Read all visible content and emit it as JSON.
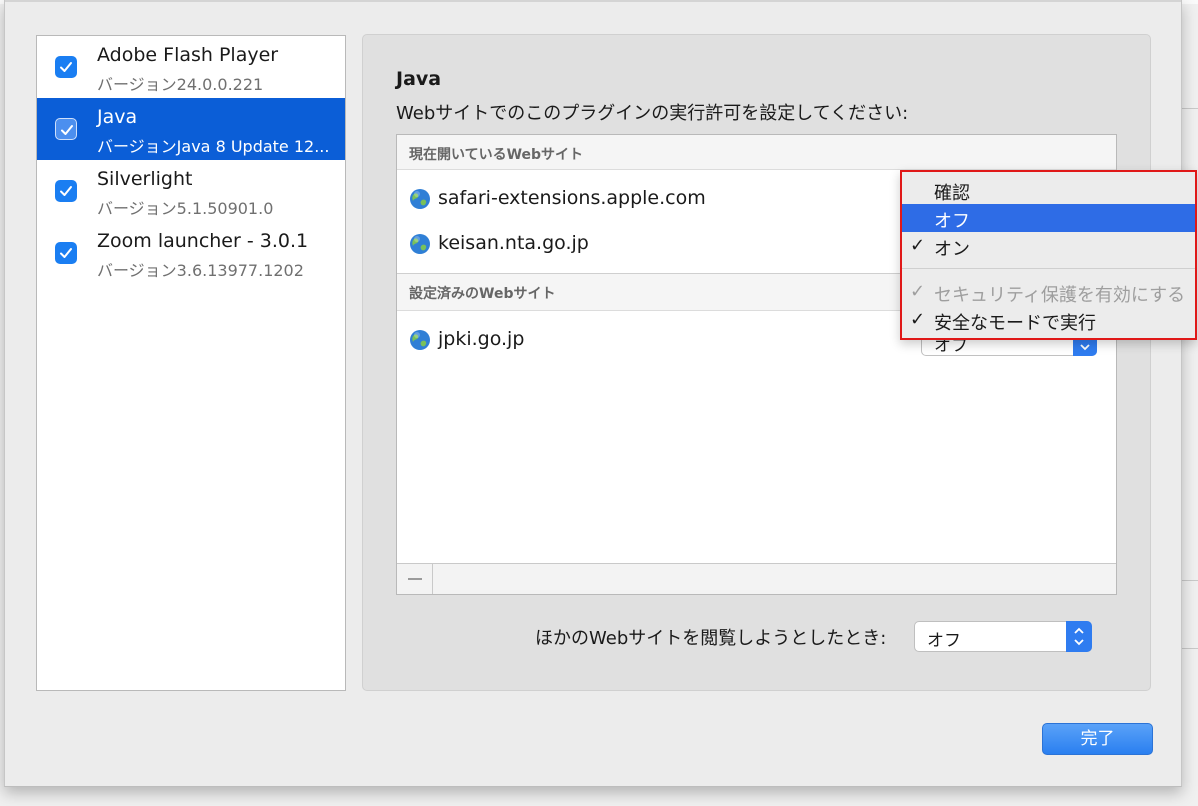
{
  "plugins": [
    {
      "name": "Adobe Flash Player",
      "version": "バージョン24.0.0.221",
      "enabled": true,
      "selected": false
    },
    {
      "name": "Java",
      "version": "バージョンJava 8 Update 12...",
      "enabled": true,
      "selected": true
    },
    {
      "name": "Silverlight",
      "version": "バージョン5.1.50901.0",
      "enabled": true,
      "selected": false
    },
    {
      "name": "Zoom launcher - 3.0.1",
      "version": "バージョン3.6.13977.1202",
      "enabled": true,
      "selected": false
    }
  ],
  "detail": {
    "title": "Java",
    "subtitle": "Webサイトでのこのプラグインの実行許可を設定してください:",
    "current_sites_header": "現在開いているWebサイト",
    "current_sites": [
      "safari-extensions.apple.com",
      "keisan.nta.go.jp"
    ],
    "configured_sites_header": "設定済みのWebサイト",
    "configured_sites": [
      {
        "name": "jpki.go.jp",
        "setting": "オフ"
      }
    ],
    "remove_symbol": "—",
    "other_sites_label": "ほかのWebサイトを閲覧しようとしたとき:",
    "other_sites_value": "オフ"
  },
  "popup_menu": {
    "items": [
      {
        "label": "確認",
        "checked": false,
        "highlighted": false,
        "disabled": false
      },
      {
        "label": "オフ",
        "checked": false,
        "highlighted": true,
        "disabled": false
      },
      {
        "label": "オン",
        "checked": true,
        "highlighted": false,
        "disabled": false
      },
      {
        "label": "セキュリティ保護を有効にする",
        "checked": true,
        "highlighted": false,
        "disabled": true
      },
      {
        "label": "安全なモードで実行",
        "checked": true,
        "highlighted": false,
        "disabled": false
      }
    ],
    "check_glyph": "✓"
  },
  "done_button": "完了",
  "colors": {
    "accent": "#0b5ed7",
    "menu_highlight": "#2e6ce6",
    "callout_border": "#e01818"
  }
}
